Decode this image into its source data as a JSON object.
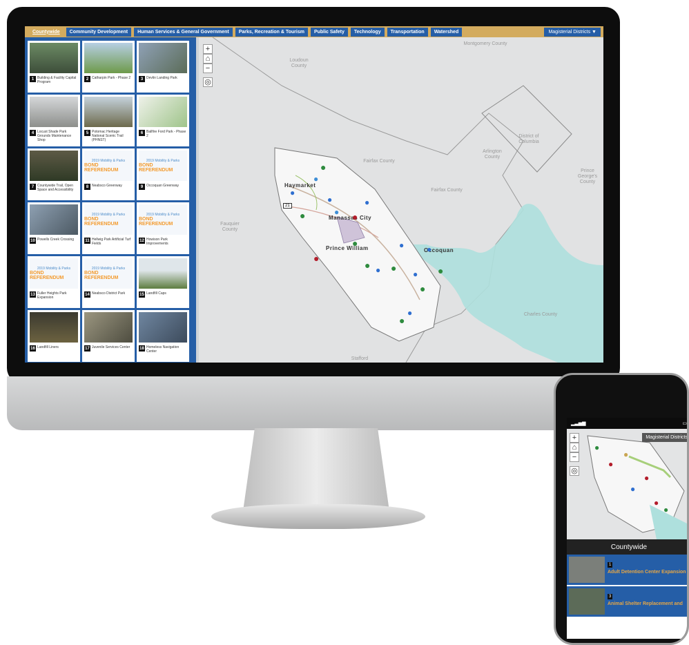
{
  "desktop": {
    "tabs": [
      "Countywide",
      "Community Development",
      "Human Services & General Government",
      "Parks, Recreation & Tourism",
      "Public Safety",
      "Technology",
      "Transportation",
      "Watershed"
    ],
    "districts_label": "Magisterial Districts ▼",
    "cards": [
      {
        "num": "1",
        "title": "Building & Facility Capital Program"
      },
      {
        "num": "2",
        "title": "Catharpin Park - Phase 2"
      },
      {
        "num": "3",
        "title": "Devlin Landing Park"
      },
      {
        "num": "4",
        "title": "Locust Shade Park Grounds Maintenance Shop"
      },
      {
        "num": "5",
        "title": "Potomac Heritage National Scenic Trail (PHNST)"
      },
      {
        "num": "6",
        "title": "Ballfire Ford Park - Phase 2"
      },
      {
        "num": "7",
        "title": "Countywide Trail, Open Space and Accessibility"
      },
      {
        "num": "8",
        "title": "Neabsco Greenway"
      },
      {
        "num": "9",
        "title": "Occoquan Greenway"
      },
      {
        "num": "10",
        "title": "Powells Creek Crossing"
      },
      {
        "num": "11",
        "title": "Hellwig Park Artificial Turf Fields"
      },
      {
        "num": "12",
        "title": "Howison Park Improvements"
      },
      {
        "num": "13",
        "title": "Fuller Heights Park Expansion"
      },
      {
        "num": "14",
        "title": "Neabsco District Park"
      },
      {
        "num": "15",
        "title": "Landfill Caps"
      },
      {
        "num": "16",
        "title": "Landfill Liners"
      },
      {
        "num": "17",
        "title": "Juvenile Services Center"
      },
      {
        "num": "18",
        "title": "Homeless Navigation Center"
      }
    ],
    "bond_line1": "2019 Mobility & Parks",
    "bond_line2": "BOND REFERENDUM",
    "map_labels": {
      "montgomery": "Montgomery County",
      "loudoun": "Loudoun County",
      "dc": "District of Columbia",
      "arlington": "Arlington County",
      "fairfax1": "Fairfax County",
      "fairfax2": "Fairfax County",
      "princegeorges": "Prince George's County",
      "fauquier": "Fauquier County",
      "charles": "Charles County",
      "stafford": "Stafford"
    },
    "cities": {
      "haymarket": "Haymarket",
      "manassas": "Manassas City",
      "pw": "Prince William",
      "occoquan": "Occoquan"
    },
    "zoom": {
      "plus": "+",
      "minus": "−"
    },
    "route_marker": "21"
  },
  "phone": {
    "districts_label": "Magisterial Districts",
    "list_title": "Countywide",
    "items": [
      {
        "num": "1",
        "title": "Adult Detention Center Expansion Phase II"
      },
      {
        "num": "3",
        "title": "Animal Shelter Replacement and"
      }
    ]
  },
  "colors": {
    "accent": "#255ea7",
    "tab_gold": "#d3ab5e",
    "bond_orange": "#f39b2e"
  }
}
